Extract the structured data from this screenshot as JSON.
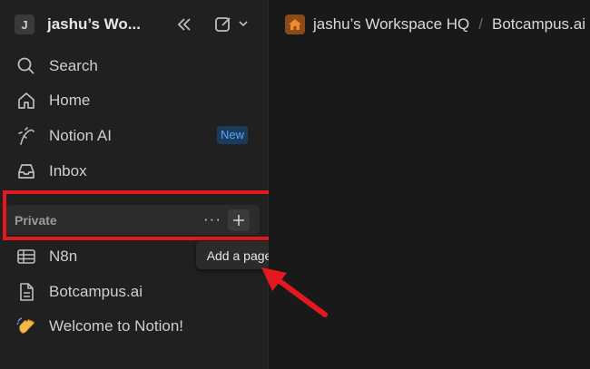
{
  "workspace": {
    "avatar_letter": "J",
    "name": "jashu’s Wo..."
  },
  "nav": {
    "search": "Search",
    "home": "Home",
    "notion_ai": "Notion AI",
    "notion_ai_badge": "New",
    "inbox": "Inbox"
  },
  "private_section": {
    "label": "Private",
    "more": "···"
  },
  "tooltip": "Add a page",
  "pages": [
    {
      "label": "N8n",
      "icon": "table-icon"
    },
    {
      "label": "Botcampus.ai",
      "icon": "page-icon"
    },
    {
      "label": "Welcome to Notion!",
      "icon": "waving-hand-emoji"
    }
  ],
  "breadcrumb": {
    "workspace": "jashu’s Workspace HQ",
    "separator": "/",
    "page": "Botcampus.ai"
  },
  "colors": {
    "sidebar_bg": "#202020",
    "main_bg": "#191919",
    "annotation_red": "#e3191f",
    "badge_blue": "#5aa4ff"
  }
}
